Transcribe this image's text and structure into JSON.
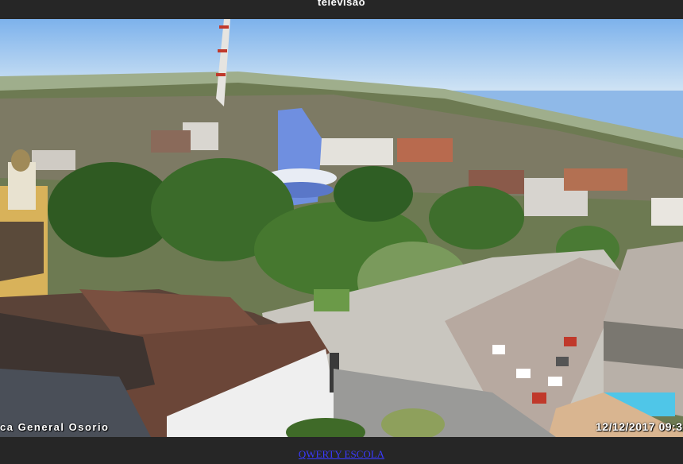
{
  "window": {
    "title": "televisão"
  },
  "video": {
    "overlay_left": "ca General Osorio",
    "overlay_right": "12/12/2017 09:3"
  },
  "footer": {
    "link_text": "QWERTY ESCOLA"
  },
  "colors": {
    "bar": "#262626",
    "link": "#3a3aff",
    "sky": "#8fb9e8"
  }
}
